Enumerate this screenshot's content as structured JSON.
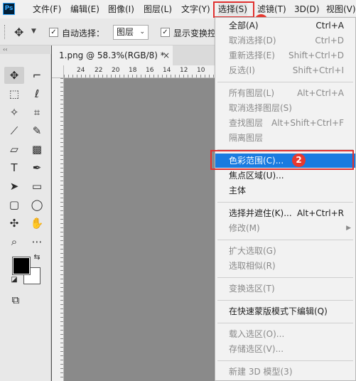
{
  "app": {
    "logo_text": "Ps"
  },
  "menubar": {
    "items": [
      {
        "label": "文件(F)"
      },
      {
        "label": "编辑(E)"
      },
      {
        "label": "图像(I)"
      },
      {
        "label": "图层(L)"
      },
      {
        "label": "文字(Y)"
      },
      {
        "label": "选择(S)"
      },
      {
        "label": "滤镜(T)"
      },
      {
        "label": "3D(D)"
      },
      {
        "label": "视图(V)"
      }
    ]
  },
  "badges": {
    "one": "1",
    "two": "2"
  },
  "options": {
    "auto_select_label": "自动选择：",
    "auto_select_checked": true,
    "layer_select_value": "图层",
    "show_transform_label": "显示变换控",
    "show_transform_checked": true
  },
  "document": {
    "tab_title": "1.png @ 58.3%(RGB/8) *",
    "close_glyph": "×"
  },
  "ruler": {
    "ticks": [
      "24",
      "22",
      "20",
      "18",
      "16",
      "14",
      "12",
      "10"
    ]
  },
  "select_menu": {
    "items": [
      {
        "label": "全部(A)",
        "shortcut": "Ctrl+A",
        "enabled": true
      },
      {
        "label": "取消选择(D)",
        "shortcut": "Ctrl+D",
        "enabled": false
      },
      {
        "label": "重新选择(E)",
        "shortcut": "Shift+Ctrl+D",
        "enabled": false
      },
      {
        "label": "反选(I)",
        "shortcut": "Shift+Ctrl+I",
        "enabled": false
      },
      {
        "label": "所有图层(L)",
        "shortcut": "Alt+Ctrl+A",
        "enabled": false
      },
      {
        "label": "取消选择图层(S)",
        "shortcut": "",
        "enabled": false
      },
      {
        "label": "查找图层",
        "shortcut": "Alt+Shift+Ctrl+F",
        "enabled": false
      },
      {
        "label": "隔离图层",
        "shortcut": "",
        "enabled": false
      },
      {
        "label": "色彩范围(C)...",
        "shortcut": "",
        "enabled": true,
        "highlighted": true
      },
      {
        "label": "焦点区域(U)...",
        "shortcut": "",
        "enabled": true
      },
      {
        "label": "主体",
        "shortcut": "",
        "enabled": true
      },
      {
        "label": "选择并遮住(K)...",
        "shortcut": "Alt+Ctrl+R",
        "enabled": true
      },
      {
        "label": "修改(M)",
        "shortcut": "",
        "enabled": false,
        "submenu": true
      },
      {
        "label": "扩大选取(G)",
        "shortcut": "",
        "enabled": false
      },
      {
        "label": "选取相似(R)",
        "shortcut": "",
        "enabled": false
      },
      {
        "label": "变换选区(T)",
        "shortcut": "",
        "enabled": false
      },
      {
        "label": "在快速蒙版模式下编辑(Q)",
        "shortcut": "",
        "enabled": true
      },
      {
        "label": "载入选区(O)...",
        "shortcut": "",
        "enabled": false
      },
      {
        "label": "存储选区(V)...",
        "shortcut": "",
        "enabled": false
      },
      {
        "label": "新建 3D 模型(3)",
        "shortcut": "",
        "enabled": false
      }
    ]
  },
  "colors": {
    "foreground": "#000000",
    "background": "#ffffff",
    "highlight": "#1a7be0",
    "annotation": "#e0302f"
  }
}
